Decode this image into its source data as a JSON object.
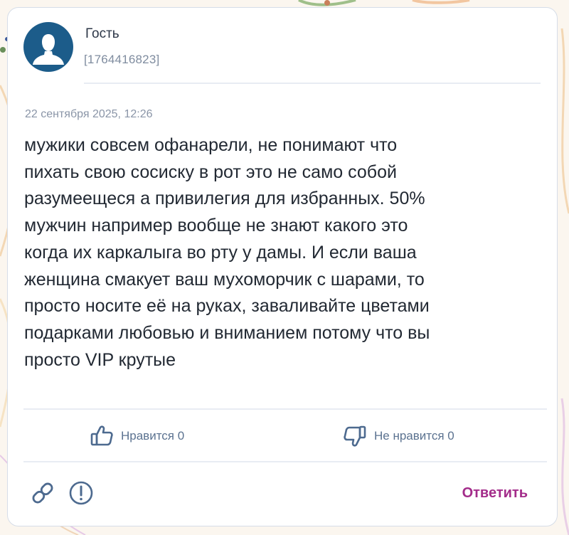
{
  "author": {
    "name": "Гость",
    "id": "[1764416823]",
    "avatar_icon": "user-silhouette-icon"
  },
  "post": {
    "date": "22 сентября 2025, 12:26",
    "text": "мужики совсем офанарели, не понимают что\nпихать свою сосиску в рот это не само собой\nразумеещеся а привилегия для избранных. 50%\nмужчин например вообще не знают какого это\nкогда их каркалыга во рту у дамы. И если ваша\nженщина смакует ваш мухоморчик с шарами, то\nпросто носите её на руках, заваливайте цветами\nподарками любовью и вниманием потому что вы\nпросто VIP крутые"
  },
  "reactions": {
    "like_label": "Нравится 0",
    "dislike_label": "Не нравится 0"
  },
  "footer": {
    "link_icon": "link-icon",
    "report_icon": "report-icon",
    "reply_label": "Ответить"
  },
  "colors": {
    "avatar_bg": "#1c5c8a",
    "reply_accent": "#a32c8a",
    "reaction_text": "#5b7290",
    "card_border": "#d6dde8"
  }
}
